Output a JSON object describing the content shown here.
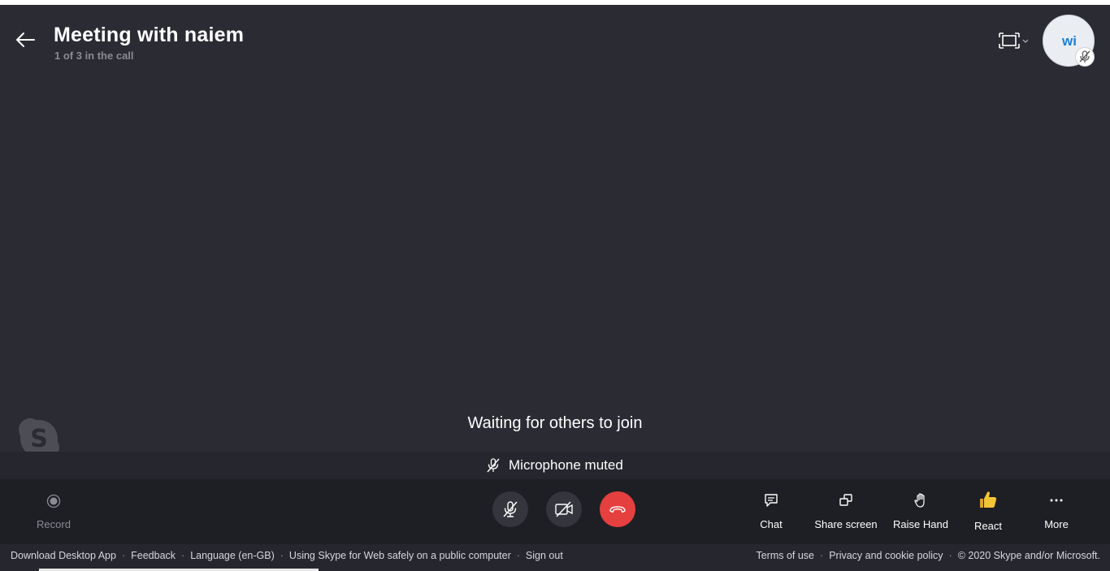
{
  "call": {
    "title": "Meeting with naiem",
    "subtitle": "1 of 3 in the call",
    "waiting_text": "Waiting for others to join",
    "mute_banner": "Microphone muted"
  },
  "avatar": {
    "initials": "wi",
    "status_icon": "mic-muted-icon"
  },
  "toolbar": {
    "record": "Record",
    "chat": "Chat",
    "share_screen": "Share screen",
    "raise_hand": "Raise Hand",
    "react": "React",
    "more": "More"
  },
  "footer": {
    "left": [
      "Download Desktop App",
      "Feedback",
      "Language (en-GB)",
      "Using Skype for Web safely on a public computer",
      "Sign out"
    ],
    "right": [
      "Terms of use",
      "Privacy and cookie policy",
      "© 2020 Skype and/or Microsoft."
    ]
  },
  "colors": {
    "background": "#2a2b33",
    "toolbar": "#1e1f24",
    "end_call": "#e63f3f",
    "avatar_text": "#1a7fd6",
    "react_icon": "#f2c438"
  }
}
